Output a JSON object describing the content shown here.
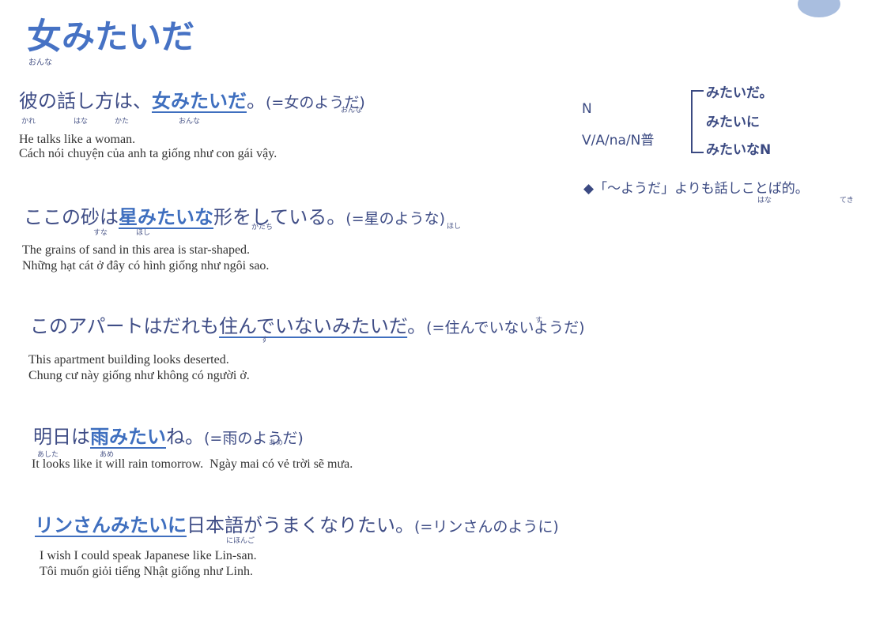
{
  "title": {
    "kanji": "女",
    "rest": "みたいだ",
    "reading": "おんな"
  },
  "grammar_box": {
    "left_top": "N",
    "left_bottom": "V/A/na/N普",
    "items": [
      "みたいだ。",
      "みたいに",
      "みたいなN"
    ],
    "note": "◆「〜ようだ」よりも話しことば的。",
    "note_furigana": [
      "はな",
      "てき"
    ]
  },
  "examples": [
    {
      "pre": "彼の話し方は、",
      "target": "女みたいだ",
      "post": "。",
      "paraphrase": "(=女のようだ)",
      "furigana": [
        "かれ",
        "はな",
        "かた",
        "おんな",
        "おんな"
      ],
      "english": "He talks like a woman.",
      "vietnamese": "Cách nói chuyện của anh ta giống như con gái vậy."
    },
    {
      "pre": "ここの砂は",
      "target": "星みたいな",
      "post": "形をしている。",
      "paraphrase": "(=星のような)",
      "furigana": [
        "すな",
        "ほし",
        "かたち",
        "ほし"
      ],
      "english": "The grains of sand in this area is star-shaped.",
      "vietnamese": "Những hạt cát ở đây có hình giống như ngôi sao."
    },
    {
      "pre": "このアパートはだれも",
      "target": "住んでいないみたいだ",
      "post": "。",
      "paraphrase": "(=住んでいないようだ)",
      "furigana": [
        "す",
        "す"
      ],
      "english": "This apartment building looks deserted.",
      "vietnamese": "Chung cư này giống như không có người ở."
    },
    {
      "pre": "明日は",
      "target": "雨みたい",
      "post": "ね。",
      "paraphrase": "(=雨のようだ)",
      "furigana": [
        "あした",
        "あめ",
        "あめ"
      ],
      "english": "It looks like it will rain tomorrow.",
      "vietnamese": "Ngày mai có vẻ trời sẽ mưa."
    },
    {
      "pre": "",
      "target": "リンさんみたいに",
      "post": "日本語がうまくなりたい。",
      "paraphrase": "(=リンさんのように)",
      "furigana": [
        "にほんご"
      ],
      "english": "I wish I could speak Japanese like Lin-san.",
      "vietnamese": "Tôi muốn giỏi tiếng Nhật giống như Linh."
    }
  ],
  "colors": {
    "accent": "#3f6fbf",
    "text": "#3b4a82",
    "title": "#4672c4"
  }
}
